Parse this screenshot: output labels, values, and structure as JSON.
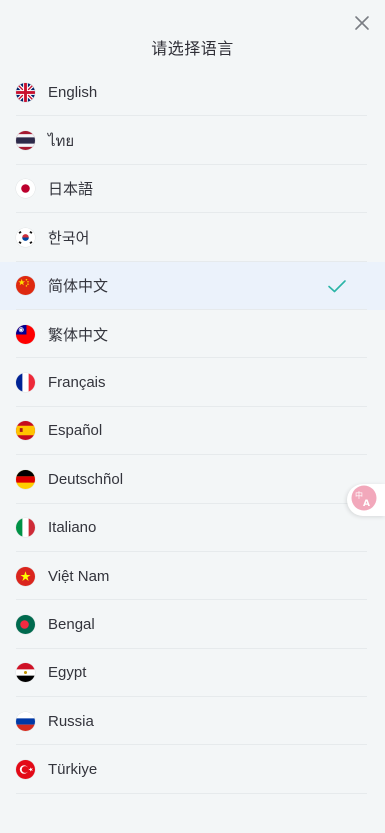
{
  "header": {
    "title": "请选择语言"
  },
  "languages": [
    {
      "label": "English",
      "flag": "uk-flag-icon"
    },
    {
      "label": "ไทย",
      "flag": "thailand-flag-icon"
    },
    {
      "label": "日本語",
      "flag": "japan-flag-icon"
    },
    {
      "label": "한국어",
      "flag": "korea-flag-icon"
    },
    {
      "label": "简体中文",
      "flag": "china-flag-icon",
      "selected": true
    },
    {
      "label": "繁体中文",
      "flag": "taiwan-flag-icon"
    },
    {
      "label": "Français",
      "flag": "france-flag-icon"
    },
    {
      "label": "Español",
      "flag": "spain-flag-icon"
    },
    {
      "label": "Deutschñol",
      "flag": "germany-flag-icon"
    },
    {
      "label": "Italiano",
      "flag": "italy-flag-icon"
    },
    {
      "label": "Việt Nam",
      "flag": "vietnam-flag-icon"
    },
    {
      "label": "Bengal",
      "flag": "bangladesh-flag-icon"
    },
    {
      "label": "Egypt",
      "flag": "egypt-flag-icon"
    },
    {
      "label": "Russia",
      "flag": "russia-flag-icon"
    },
    {
      "label": "Türkiye",
      "flag": "turkey-flag-icon"
    }
  ],
  "colors": {
    "accent_check": "#2bb5a6",
    "selected_row_bg": "#ebf2fb",
    "translate_icon": "#ec7d9a"
  }
}
